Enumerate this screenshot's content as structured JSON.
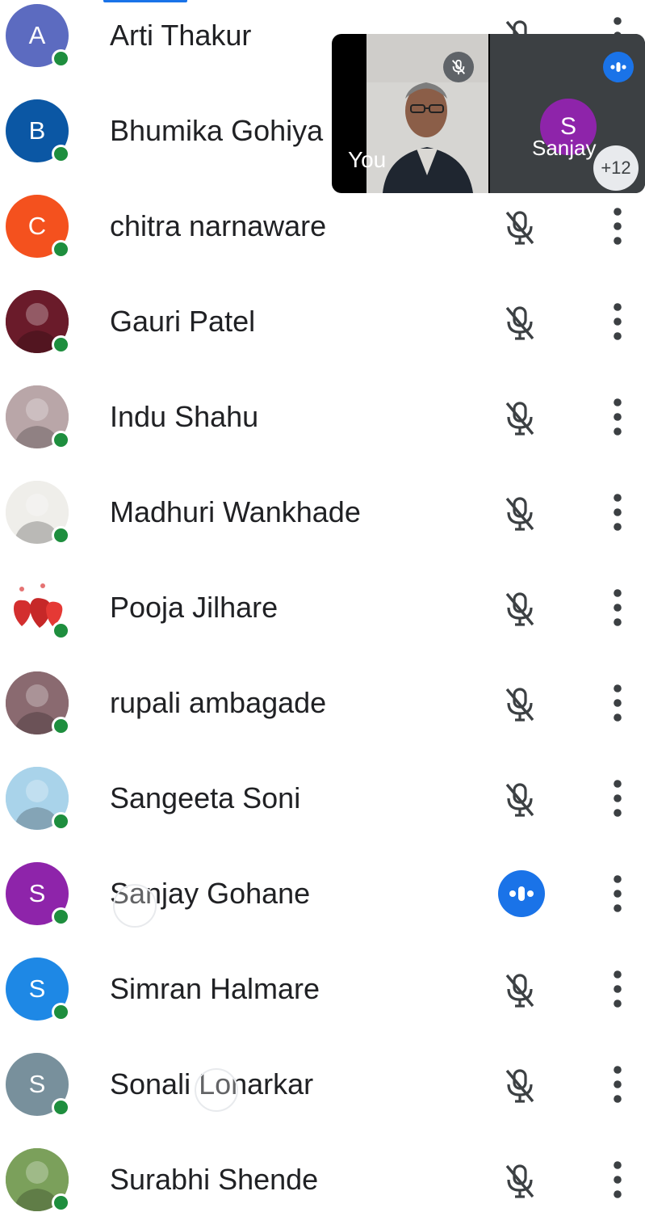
{
  "colors": {
    "accent": "#1a73e8",
    "presence": "#1e8e3e",
    "icon": "#3c4043",
    "text": "#202124"
  },
  "participants": [
    {
      "name": "Arti Thakur",
      "initial": "A",
      "avatar_color": "#5c6bc0",
      "avatar_type": "letter",
      "status": "muted"
    },
    {
      "name": "Bhumika Gohiya",
      "initial": "B",
      "avatar_color": "#0b57a4",
      "avatar_type": "letter",
      "status": "muted"
    },
    {
      "name": "chitra narnaware",
      "initial": "C",
      "avatar_color": "#f4511e",
      "avatar_type": "letter",
      "status": "muted"
    },
    {
      "name": "Gauri Patel",
      "initial": "",
      "avatar_color": "#6a1b2a",
      "avatar_type": "photo",
      "status": "muted"
    },
    {
      "name": "Indu Shahu",
      "initial": "",
      "avatar_color": "#b9a6a8",
      "avatar_type": "photo",
      "status": "muted"
    },
    {
      "name": "Madhuri Wankhade",
      "initial": "",
      "avatar_color": "#efeeea",
      "avatar_type": "photo",
      "status": "muted"
    },
    {
      "name": "Pooja Jilhare",
      "initial": "",
      "avatar_color": "#ffffff",
      "avatar_type": "hearts",
      "status": "muted"
    },
    {
      "name": "rupali ambagade",
      "initial": "",
      "avatar_color": "#8a6a70",
      "avatar_type": "photo",
      "status": "muted"
    },
    {
      "name": "Sangeeta Soni",
      "initial": "",
      "avatar_color": "#a9d3ea",
      "avatar_type": "photo",
      "status": "muted"
    },
    {
      "name": "Sanjay Gohane",
      "initial": "S",
      "avatar_color": "#8e24aa",
      "avatar_type": "letter",
      "status": "speaking"
    },
    {
      "name": "Simran Halmare",
      "initial": "S",
      "avatar_color": "#1e88e5",
      "avatar_type": "letter",
      "status": "muted"
    },
    {
      "name": "Sonali Lonarkar",
      "initial": "S",
      "avatar_color": "#78909c",
      "avatar_type": "letter",
      "status": "muted"
    },
    {
      "name": "Surabhi Shende",
      "initial": "",
      "avatar_color": "#7ba05b",
      "avatar_type": "photo",
      "status": "muted"
    }
  ],
  "pip": {
    "self_label": "You",
    "other_name": "Sanjay",
    "other_initial": "S",
    "other_avatar_color": "#8e24aa",
    "others_count": "+12"
  }
}
